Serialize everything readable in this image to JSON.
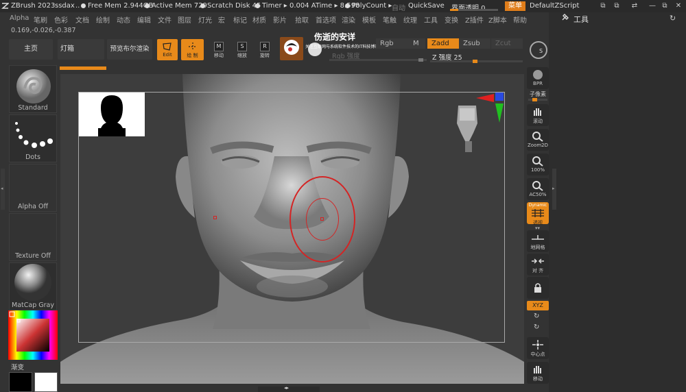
{
  "titlebar": {
    "app": "ZBrush 2023",
    "user": "ssdax",
    "ellipsis": "..",
    "free_mem": "Free Mem 2.944GB",
    "active_mem": "Active Mem 729",
    "scratch_disk": "Scratch Disk 45",
    "timer": "Timer ▸ 0.004 ATime ▸ 8.598",
    "polycount": "PolyCount ▸",
    "auto": "自动",
    "quicksave": "QuickSave",
    "interface_transparency": "界面透明 0",
    "interface_transparency_value": 0,
    "menus_button": "菜单",
    "script_name": "DefaultZScript"
  },
  "menubar": [
    "Alpha",
    "笔刷",
    "色彩",
    "文档",
    "绘制",
    "动态",
    "编辑",
    "文件",
    "图层",
    "灯光",
    "宏",
    "标记",
    "材质",
    "影片",
    "拾取",
    "首选项",
    "渲染",
    "模板",
    "笔触",
    "纹理",
    "工具",
    "变换",
    "Z插件",
    "Z脚本",
    "帮助"
  ],
  "coordinates": "0.169,-0.026,-0.387",
  "tool_palette": {
    "title": "工具"
  },
  "shelf": {
    "home": "主页",
    "lightbox": "灯箱",
    "bpr_preview": "预览布尔渲染",
    "edit": "Edit",
    "draw": "绘 制",
    "move": "移动",
    "scale": "缩放",
    "rotate": "旋转",
    "move_key": "M",
    "scale_key": "S",
    "rotate_key": "R",
    "rgb": "Rgb",
    "m": "M",
    "zadd": "Zadd",
    "zsub": "Zsub",
    "zcut": "Zcut",
    "rgb_intensity": "Rgb 强度",
    "z_intensity": "Z 强度 25",
    "z_intensity_value": 25
  },
  "watermark": {
    "title": "伤逝的安详",
    "subtitle": "关注互联网与系统软件技术的IT科技博客"
  },
  "left_shelf": {
    "brush": "Standard",
    "stroke": "Dots",
    "alpha": "Alpha Off",
    "texture": "Texture Off",
    "material": "MatCap Gray",
    "gradient": "渐变"
  },
  "right_shelf": {
    "bpr": "BPR",
    "subpixel": "子像素",
    "scroll": "滚动",
    "zoom2d": "Zoom2D",
    "pct100": "100%",
    "ac50": "AC50%",
    "dynamic": "Dynamic",
    "perspective": "透视",
    "floor": "地网格",
    "align": "对 齐",
    "lock": "",
    "xyz": "XYZ",
    "center": "中心点",
    "move": "移动"
  },
  "colors": {
    "accent": "#e88a1a",
    "bg": "#333333",
    "canvas": "#3d3d3d",
    "brush_circle": "#d42424"
  }
}
